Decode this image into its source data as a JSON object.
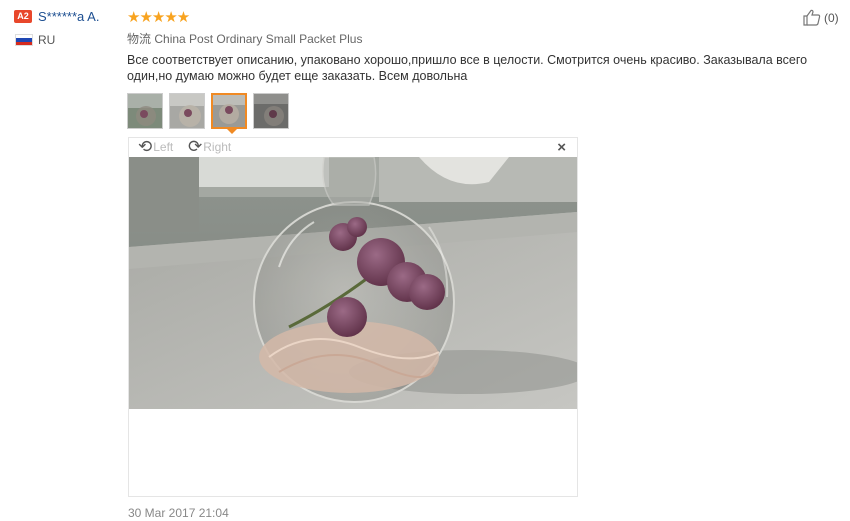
{
  "user": {
    "badge": "A2",
    "name": "S******a A.",
    "country": "RU",
    "flag_colors": [
      "#ffffff",
      "#1f47b3",
      "#d52b1e"
    ]
  },
  "review": {
    "rating": 5,
    "stars": "★★★★★",
    "shipping_prefix": "物流",
    "shipping_method": "China Post Ordinary Small Packet Plus",
    "text": "Все соответствует описанию, упаковано хорошо,пришло все в целости. Смотрится очень красиво. Заказывала всего один,но думаю можно будет еще заказать. Всем довольна",
    "date": "30 Mar 2017 21:04"
  },
  "thumbnails": {
    "count": 4,
    "selected_index": 2
  },
  "viewer": {
    "rotate_left_label": "Left",
    "rotate_right_label": "Right",
    "close_label": "×"
  },
  "helpful": {
    "count_label": "(0)"
  },
  "colors": {
    "accent_orange": "#f08a24",
    "star": "#f8a31f",
    "link_blue": "#1d4f91",
    "badge_red": "#e8472b"
  },
  "icons": [
    "rotate-left-icon",
    "rotate-right-icon",
    "close-icon",
    "thumbs-up-icon",
    "flag-icon"
  ]
}
